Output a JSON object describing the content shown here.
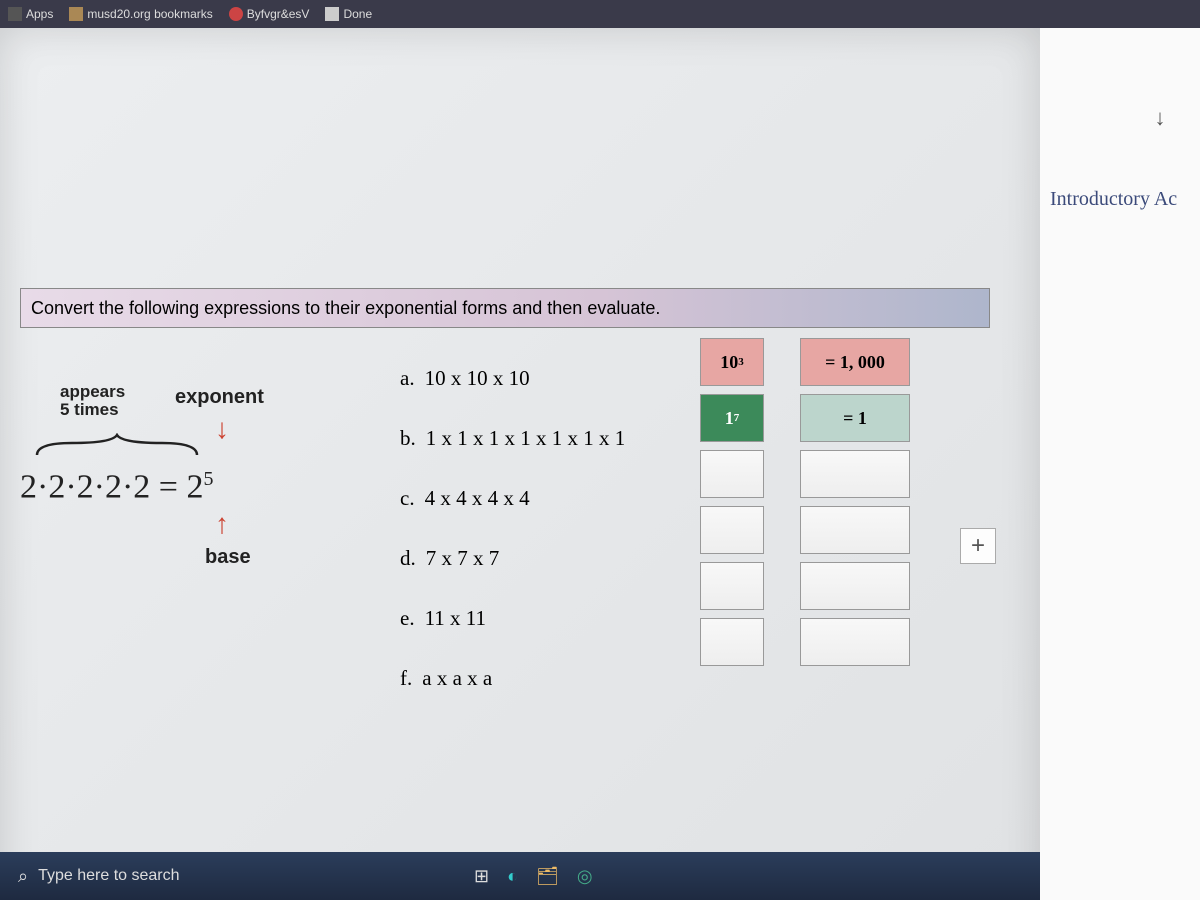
{
  "bookmarks_bar": {
    "apps_label": "Apps",
    "items": [
      {
        "label": "musd20.org bookmarks"
      },
      {
        "label": "Byfvgr&esV"
      },
      {
        "label": "Done"
      }
    ]
  },
  "right_panel": {
    "title_fragment": "Introductory Ac"
  },
  "instruction": "Convert the following expressions to their exponential forms and then evaluate.",
  "example": {
    "appears_text_line1": "appears",
    "appears_text_line2": "5 times",
    "exponent_label": "exponent",
    "equation_lhs": "2·2·2·2·2",
    "equation_rhs_base": "2",
    "equation_rhs_exp": "5",
    "base_label": "base"
  },
  "problems": [
    {
      "letter": "a.",
      "expr": "10 x 10 x 10"
    },
    {
      "letter": "b.",
      "expr": "1 x 1 x 1 x 1 x 1 x 1 x 1"
    },
    {
      "letter": "c.",
      "expr": "4 x 4 x 4 x 4"
    },
    {
      "letter": "d.",
      "expr": "7 x 7 x 7"
    },
    {
      "letter": "e.",
      "expr": "11 x 11"
    },
    {
      "letter": "f.",
      "expr": "a x a x a"
    }
  ],
  "answers_exponent_col": [
    {
      "base": "10",
      "exp": "3",
      "style": "pink"
    },
    {
      "base": "1",
      "exp": "7",
      "style": "green"
    },
    {
      "base": "",
      "exp": "",
      "style": "blank"
    },
    {
      "base": "",
      "exp": "",
      "style": "blank"
    },
    {
      "base": "",
      "exp": "",
      "style": "blank"
    },
    {
      "base": "",
      "exp": "",
      "style": "blank"
    }
  ],
  "answers_value_col": [
    {
      "value": "= 1, 000",
      "style": "pink"
    },
    {
      "value": "= 1",
      "style": "teal"
    },
    {
      "value": "",
      "style": "blank"
    },
    {
      "value": "",
      "style": "blank"
    },
    {
      "value": "",
      "style": "blank"
    },
    {
      "value": "",
      "style": "blank"
    }
  ],
  "taskbar": {
    "search_placeholder": "Type here to search"
  }
}
